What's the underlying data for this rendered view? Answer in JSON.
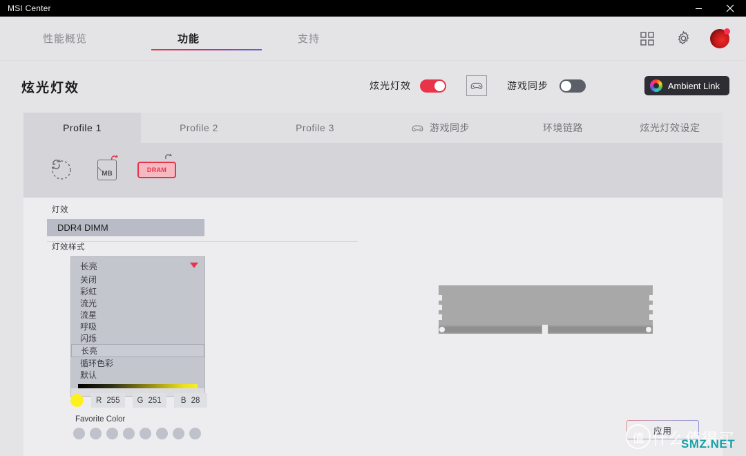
{
  "window": {
    "title": "MSI Center",
    "minimize_label": "minimize",
    "close_label": "close"
  },
  "topnav": {
    "tabs": [
      {
        "label": "性能概览",
        "active": false
      },
      {
        "label": "功能",
        "active": true
      },
      {
        "label": "支持",
        "active": false
      }
    ],
    "icons": [
      {
        "name": "apps-grid-icon"
      },
      {
        "name": "gear-icon"
      },
      {
        "name": "avatar"
      }
    ],
    "accent_gradient_from": "#e8334a",
    "accent_gradient_to": "#5a63d8"
  },
  "header": {
    "title": "炫光灯效",
    "mystic_light_label": "炫光灯效",
    "mystic_light_state": "on",
    "gamepad_icon": "gamepad-icon",
    "game_sync_label": "游戏同步",
    "game_sync_state": "on",
    "ambient_link_label": "Ambient Link"
  },
  "profile_tabs": [
    {
      "label": "Profile 1",
      "active": true
    },
    {
      "label": "Profile 2",
      "active": false
    },
    {
      "label": "Profile 3",
      "active": false
    },
    {
      "label": "游戏同步",
      "active": false,
      "icon": "gamepad-icon"
    },
    {
      "label": "环境链路",
      "active": false
    },
    {
      "label": "炫光灯效设定",
      "active": false
    }
  ],
  "devices": [
    {
      "name": "sync-all-icon",
      "label": "",
      "selected": false
    },
    {
      "name": "motherboard-icon",
      "label": "MB",
      "selected": false
    },
    {
      "name": "dram-icon",
      "label": "DRAM",
      "selected": true
    }
  ],
  "effect_section": {
    "label": "灯效",
    "selected_device": "DDR4 DIMM",
    "style_label": "灯效样式",
    "dropdown": {
      "selected": "长亮",
      "options": [
        "关闭",
        "彩虹",
        "流光",
        "流星",
        "呼吸",
        "闪烁",
        "长亮",
        "循环色彩",
        "默认"
      ],
      "selected_index": 6
    },
    "color": {
      "swatch_hex": "#fdf01e",
      "r_label": "R",
      "r_value": "255",
      "g_label": "G",
      "g_value": "251",
      "b_label": "B",
      "b_value": "28"
    },
    "favorite_color_label": "Favorite Color",
    "favorite_swatch_count": 8
  },
  "preview": {
    "device_art": "ddr4-dimm-illustration"
  },
  "apply_button": {
    "label": "应用"
  },
  "watermark": {
    "mark": "值",
    "text": "什么值得买",
    "sub": "SMZ.NET"
  }
}
